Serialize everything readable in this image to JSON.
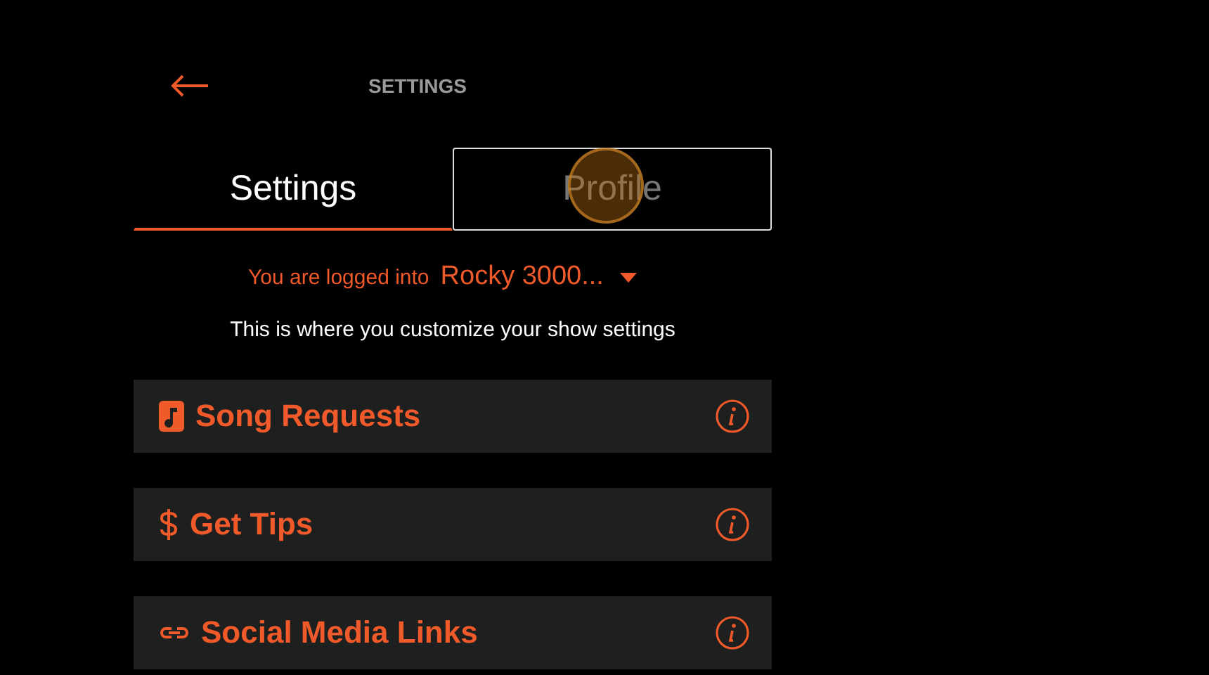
{
  "header": {
    "title": "SETTINGS"
  },
  "tabs": [
    {
      "label": "Settings",
      "selected": true,
      "focused": false
    },
    {
      "label": "Profile",
      "selected": false,
      "focused": true
    }
  ],
  "login": {
    "prefix": "You are logged into",
    "account": "Rocky 3000..."
  },
  "description": "This is where you customize your show settings",
  "sections": [
    {
      "kind": "music",
      "title": "Song Requests"
    },
    {
      "kind": "dollar",
      "title": "Get Tips"
    },
    {
      "kind": "link",
      "title": "Social Media Links"
    }
  ]
}
